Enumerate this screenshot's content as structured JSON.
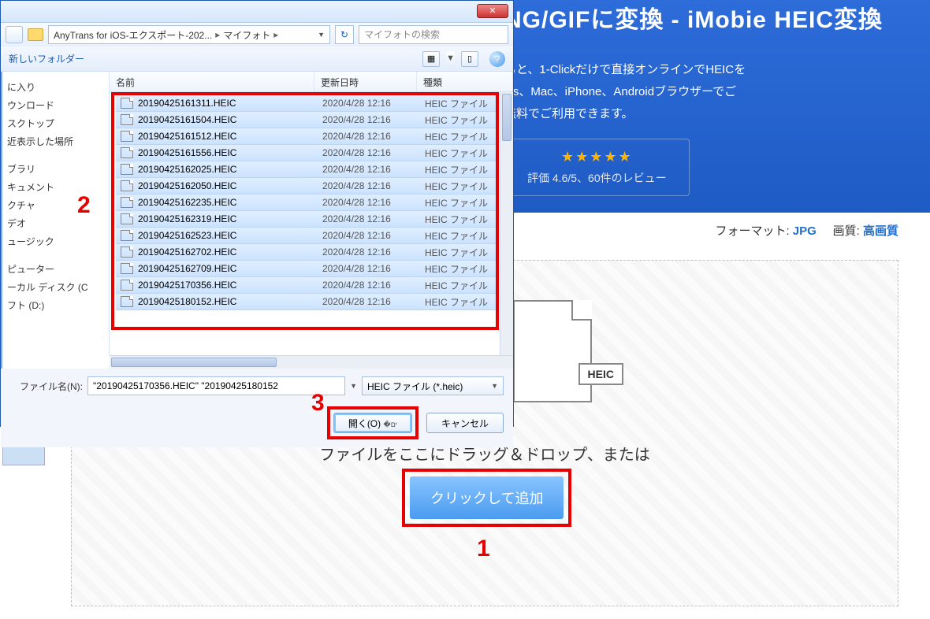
{
  "page": {
    "title": "NG/GIFに変換 - iMobie HEIC変換",
    "desc1": "ると、1-Clickだけで直接オンラインでHEICを",
    "desc2": "ws、Mac、iPhone、Androidブラウザーでご",
    "desc3": "無料でご利用できます。",
    "rating_text": "評価 4.6/5、60件のレビュー",
    "format_label": "フォーマット:",
    "format_value": "JPG",
    "quality_label": "画質:",
    "quality_value": "高画質",
    "drop_text": "ファイルをここにドラッグ＆ドロップ、または",
    "heic_badge": "HEIC",
    "add_button": "クリックして追加"
  },
  "markers": {
    "m1": "1",
    "m2": "2",
    "m3": "3"
  },
  "dialog": {
    "close": "✕",
    "crumb1": "AnyTrans for iOS-エクスポート-202...",
    "crumb2": "マイフォト",
    "refresh": "↻",
    "search_placeholder": "マイフォトの検索",
    "new_folder": "新しいフォルダー",
    "view_icon": "▦",
    "preview_icon": "▯",
    "help": "?",
    "col_name": "名前",
    "col_date": "更新日時",
    "col_type": "種類",
    "sidebar": {
      "g1": [
        "に入り",
        "ウンロード",
        "スクトップ",
        "近表示した場所"
      ],
      "g2": [
        "ブラリ",
        "キュメント",
        "クチャ",
        "デオ",
        "ュージック"
      ],
      "g3": [
        "ピューター",
        "ーカル ディスク (C",
        "フト (D:)"
      ]
    },
    "files": [
      {
        "n": "20190425161311.HEIC",
        "d": "2020/4/28 12:16",
        "t": "HEIC ファイル"
      },
      {
        "n": "20190425161504.HEIC",
        "d": "2020/4/28 12:16",
        "t": "HEIC ファイル"
      },
      {
        "n": "20190425161512.HEIC",
        "d": "2020/4/28 12:16",
        "t": "HEIC ファイル"
      },
      {
        "n": "20190425161556.HEIC",
        "d": "2020/4/28 12:16",
        "t": "HEIC ファイル"
      },
      {
        "n": "20190425162025.HEIC",
        "d": "2020/4/28 12:16",
        "t": "HEIC ファイル"
      },
      {
        "n": "20190425162050.HEIC",
        "d": "2020/4/28 12:16",
        "t": "HEIC ファイル"
      },
      {
        "n": "20190425162235.HEIC",
        "d": "2020/4/28 12:16",
        "t": "HEIC ファイル"
      },
      {
        "n": "20190425162319.HEIC",
        "d": "2020/4/28 12:16",
        "t": "HEIC ファイル"
      },
      {
        "n": "20190425162523.HEIC",
        "d": "2020/4/28 12:16",
        "t": "HEIC ファイル"
      },
      {
        "n": "20190425162702.HEIC",
        "d": "2020/4/28 12:16",
        "t": "HEIC ファイル"
      },
      {
        "n": "20190425162709.HEIC",
        "d": "2020/4/28 12:16",
        "t": "HEIC ファイル"
      },
      {
        "n": "20190425170356.HEIC",
        "d": "2020/4/28 12:16",
        "t": "HEIC ファイル"
      },
      {
        "n": "20190425180152.HEIC",
        "d": "2020/4/28 12:16",
        "t": "HEIC ファイル"
      }
    ],
    "filename_label": "ファイル名(N):",
    "filename_value": "\"20190425170356.HEIC\" \"20190425180152",
    "filter_value": "HEIC ファイル (*.heic)",
    "open_btn": "開く(O)",
    "cancel_btn": "キャンセル"
  }
}
